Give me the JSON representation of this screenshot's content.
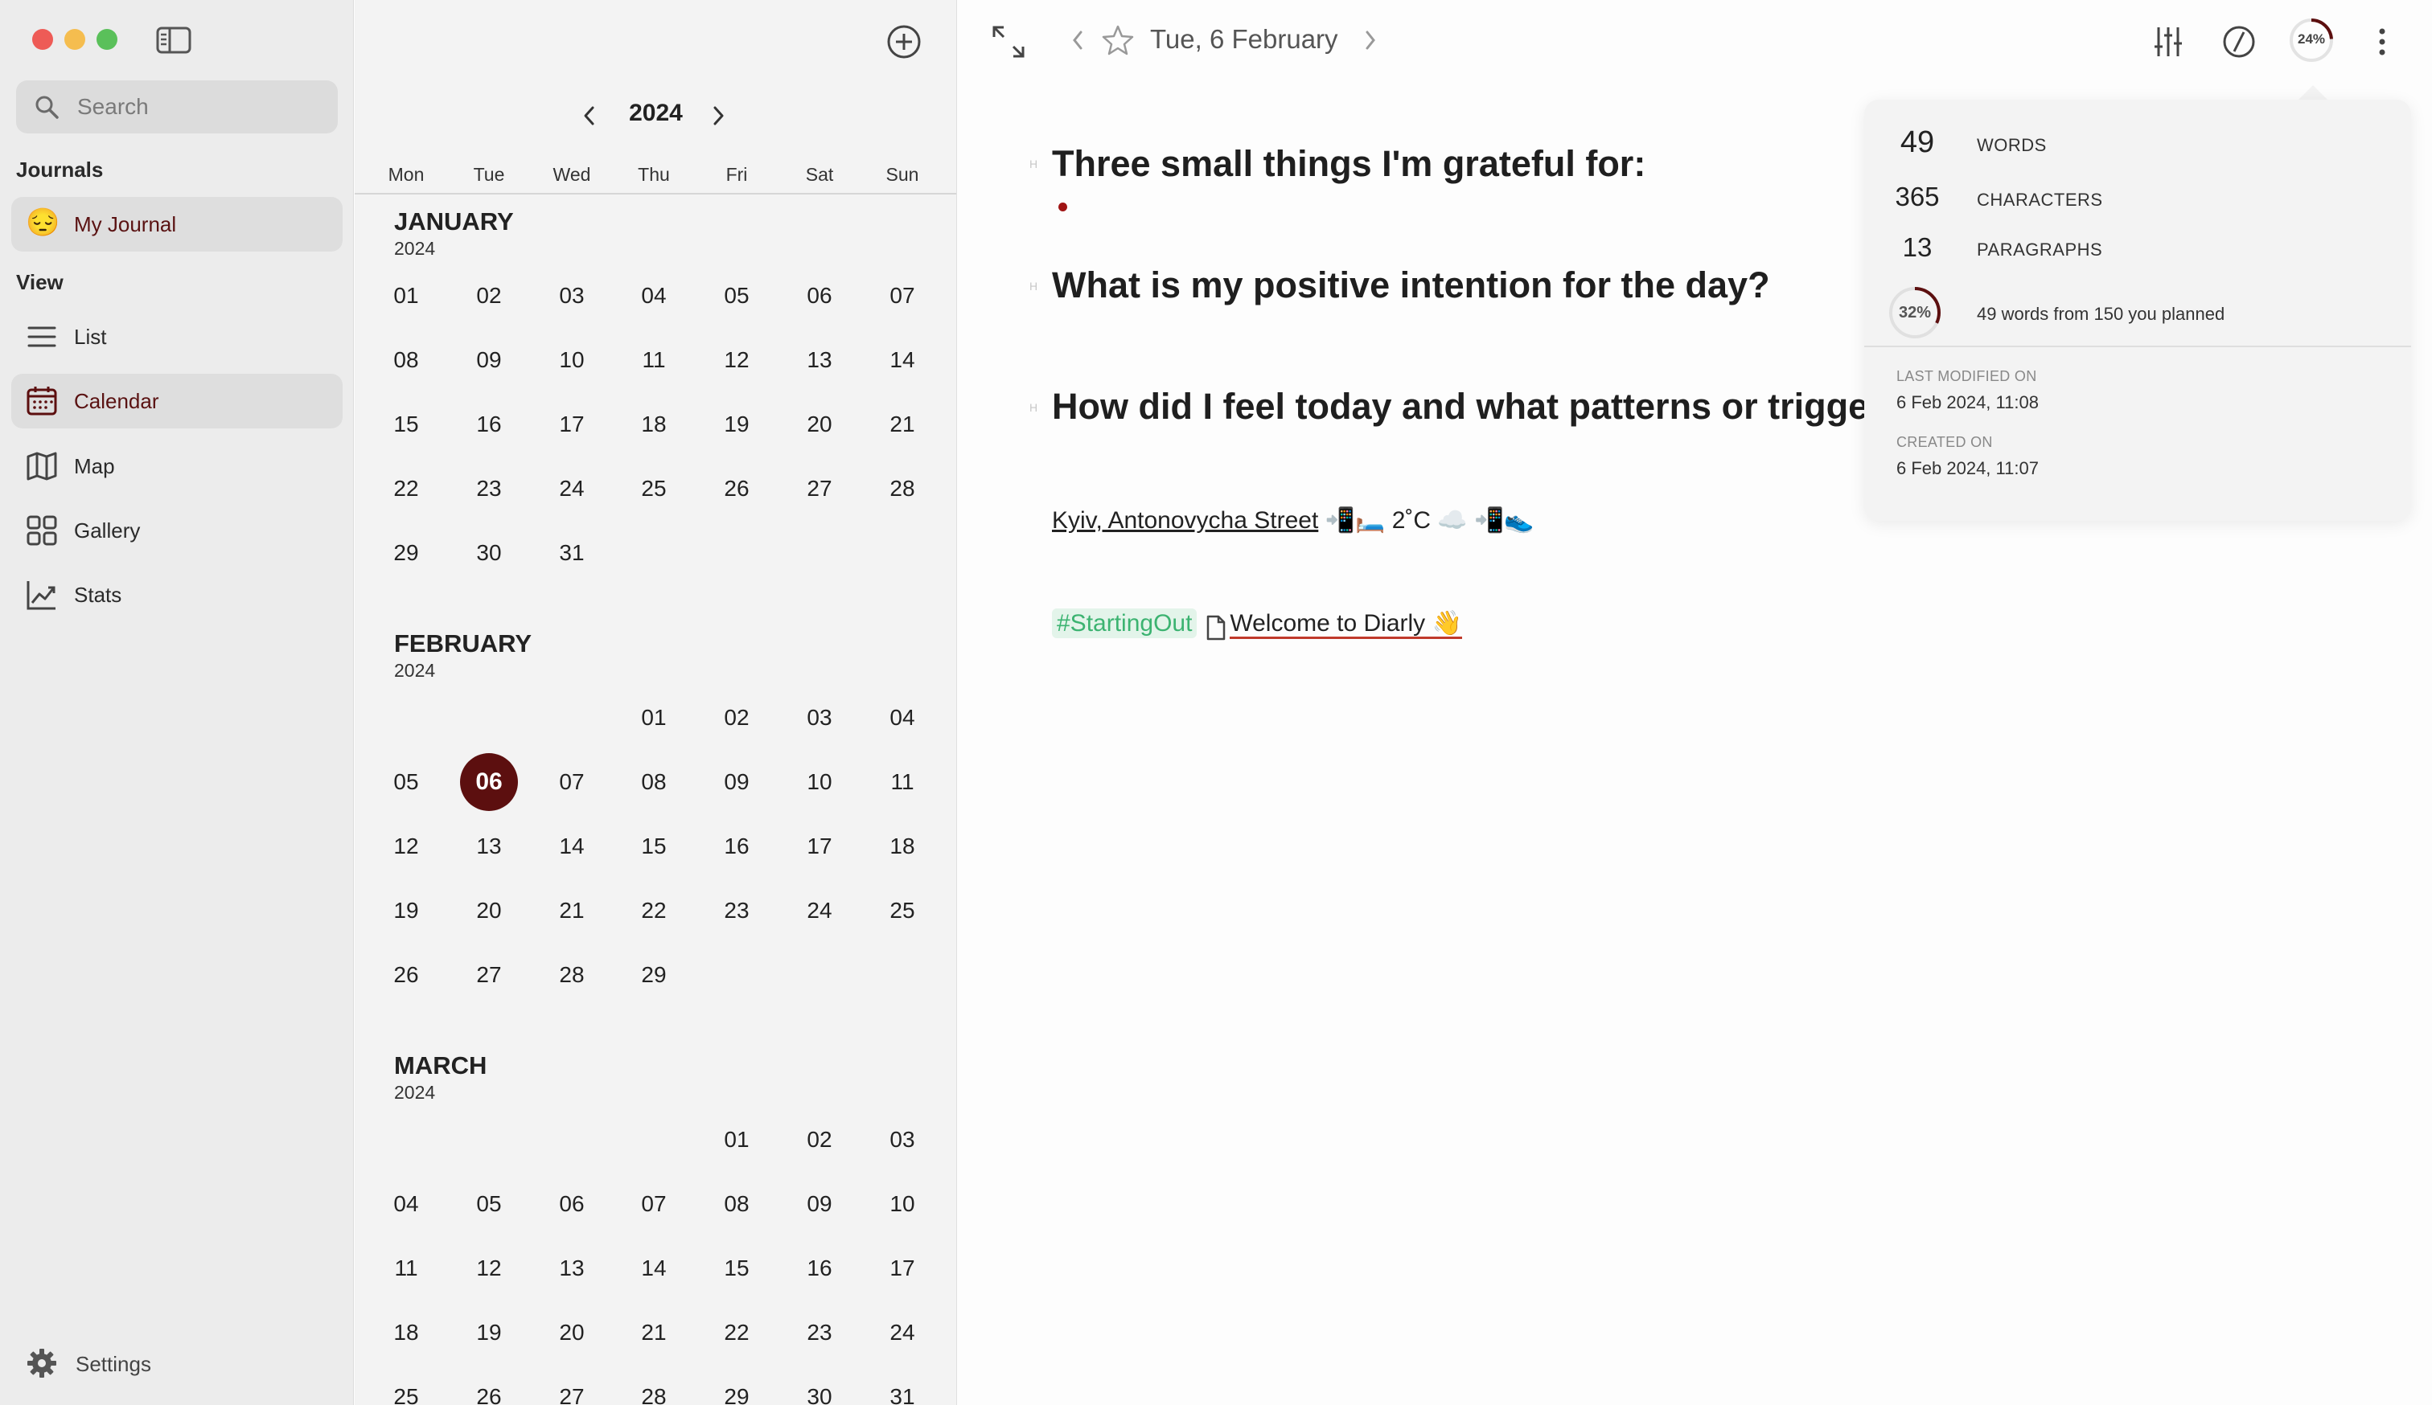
{
  "sidebar": {
    "search_placeholder": "Search",
    "journals_label": "Journals",
    "journal_name": "My Journal",
    "journal_emoji": "😔",
    "view_label": "View",
    "nav": [
      {
        "label": "List",
        "icon": "list-icon"
      },
      {
        "label": "Calendar",
        "icon": "calendar-icon"
      },
      {
        "label": "Map",
        "icon": "map-icon"
      },
      {
        "label": "Gallery",
        "icon": "gallery-icon"
      },
      {
        "label": "Stats",
        "icon": "stats-icon"
      }
    ],
    "selected_nav": "Calendar",
    "settings_label": "Settings"
  },
  "calendar": {
    "year": "2024",
    "weekdays": [
      "Mon",
      "Tue",
      "Wed",
      "Thu",
      "Fri",
      "Sat",
      "Sun"
    ],
    "today": "06",
    "months": [
      {
        "name": "JANUARY",
        "year": "2024",
        "offset": 0,
        "days": 31
      },
      {
        "name": "FEBRUARY",
        "year": "2024",
        "offset": 3,
        "days": 29
      },
      {
        "name": "MARCH",
        "year": "2024",
        "offset": 4,
        "days": 31
      }
    ]
  },
  "toolbar": {
    "date": "Tue, 6 February",
    "progress_label": "24%",
    "progress_value": 24
  },
  "editor": {
    "headings": [
      "Three small things I'm grateful for:",
      "What is my positive intention for the day?",
      "How did I feel today and what patterns or triggers"
    ],
    "heading_marker": "H",
    "location": "Kyiv, Antonovycha Street",
    "weather_icons": "📲🛏️",
    "temperature": "2˚C",
    "weather_after": "☁️ 📲👟",
    "tag": "#StartingOut",
    "linked_page": "Welcome to Diarly 👋"
  },
  "stats": {
    "words": "49",
    "words_label": "WORDS",
    "characters": "365",
    "characters_label": "CHARACTERS",
    "paragraphs": "13",
    "paragraphs_label": "PARAGRAPHS",
    "goal_percent_label": "32%",
    "goal_percent": 32,
    "goal_text": "49 words from 150 you planned",
    "last_modified_label": "LAST MODIFIED ON",
    "last_modified": "6 Feb 2024, 11:08",
    "created_label": "CREATED ON",
    "created": "6 Feb 2024, 11:07"
  },
  "colors": {
    "accent": "#5c0f0f",
    "tag": "#3cb371",
    "traffic_red": "#ee5b56",
    "traffic_yellow": "#f5bd4f",
    "traffic_green": "#5ac05a"
  }
}
